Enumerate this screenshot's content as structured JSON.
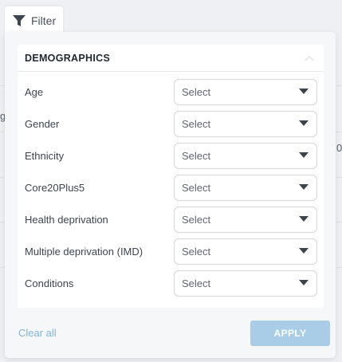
{
  "filter_tab": {
    "label": "Filter",
    "icon": "funnel-icon"
  },
  "background": {
    "fragment_left": "g",
    "fragment_right": "0"
  },
  "panel": {
    "section": {
      "title": "DEMOGRAPHICS",
      "collapse_icon": "chevron-up-icon"
    },
    "filters": [
      {
        "label": "Age",
        "value": "Select"
      },
      {
        "label": "Gender",
        "value": "Select"
      },
      {
        "label": "Ethnicity",
        "value": "Select"
      },
      {
        "label": "Core20Plus5",
        "value": "Select"
      },
      {
        "label": "Health deprivation",
        "value": "Select"
      },
      {
        "label": "Multiple deprivation (IMD)",
        "value": "Select"
      },
      {
        "label": "Conditions",
        "value": "Select"
      }
    ],
    "clear_label": "Clear all",
    "apply_label": "APPLY"
  },
  "colors": {
    "accent_link": "#7fb5d9",
    "apply_button": "#a9cde6",
    "caret": "#3d4550"
  }
}
